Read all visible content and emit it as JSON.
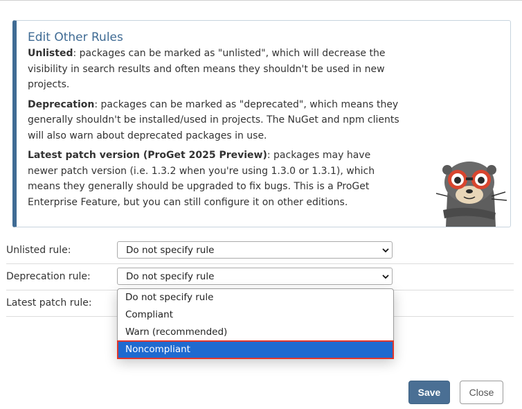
{
  "info": {
    "title": "Edit Other Rules",
    "unlisted_term": "Unlisted",
    "unlisted_desc": ": packages can be marked as \"unlisted\", which will decrease the visibility in search results and often means they shouldn't be used in new projects.",
    "deprecation_term": "Deprecation",
    "deprecation_desc": ": packages can be marked as \"deprecated\", which means they generally shouldn't be installed/used in projects. The NuGet and npm clients will also warn about deprecated packages in use.",
    "patch_term": "Latest patch version (ProGet 2025 Preview)",
    "patch_desc": ": packages may have newer patch version (i.e. 1.3.2 when you're using 1.3.0 or 1.3.1), which means they generally should be upgraded to fix bugs. This is a ProGet Enterprise Feature, but you can still configure it on other editions."
  },
  "form": {
    "unlisted": {
      "label": "Unlisted rule:",
      "value": "Do not specify rule"
    },
    "deprecation": {
      "label": "Deprecation rule:",
      "value": "Do not specify rule"
    },
    "patch": {
      "label": "Latest patch rule:"
    }
  },
  "dropdown": {
    "options": [
      "Do not specify rule",
      "Compliant",
      "Warn (recommended)",
      "Noncompliant"
    ],
    "highlighted": "Noncompliant"
  },
  "buttons": {
    "save": "Save",
    "close": "Close"
  },
  "colors": {
    "accent": "#3f6b94",
    "highlight": "#1e6ad0",
    "highlight_border": "#e0362c"
  }
}
